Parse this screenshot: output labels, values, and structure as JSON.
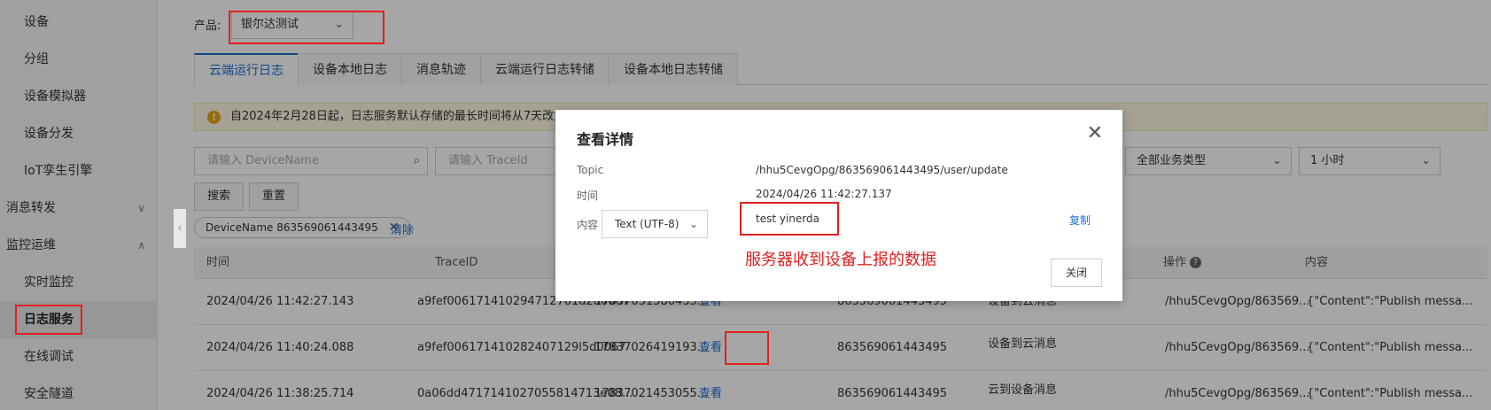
{
  "sidebar": {
    "items": [
      {
        "label": "设备",
        "type": "sub"
      },
      {
        "label": "分组",
        "type": "sub"
      },
      {
        "label": "设备模拟器",
        "type": "sub"
      },
      {
        "label": "设备分发",
        "type": "sub"
      },
      {
        "label": "IoT孪生引擎",
        "type": "sub"
      },
      {
        "label": "消息转发",
        "type": "group",
        "chevron": "∨"
      },
      {
        "label": "监控运维",
        "type": "group",
        "chevron": "∧"
      },
      {
        "label": "实时监控",
        "type": "sub"
      },
      {
        "label": "日志服务",
        "type": "sub",
        "active": true
      },
      {
        "label": "在线调试",
        "type": "sub"
      },
      {
        "label": "安全隧道",
        "type": "sub"
      }
    ]
  },
  "product": {
    "label": "产品:",
    "value": "银尔达测试"
  },
  "tabs": [
    "云端运行日志",
    "设备本地日志",
    "消息轨迹",
    "云端运行日志转储",
    "设备本地日志转储"
  ],
  "notice": {
    "text": "自2024年2月28日起，日志服务默认存储的最长时间将从7天改为3天，"
  },
  "filters": {
    "device_placeholder": "请输入 DeviceName",
    "trace_placeholder": "请输入 TraceId",
    "biz_type": "全部业务类型",
    "time_range": "1 小时"
  },
  "buttons": {
    "search": "搜索",
    "reset": "重置"
  },
  "tag": {
    "label": "DeviceName",
    "value": "863569061443495",
    "remove": "✕"
  },
  "clear_label": "清除",
  "table": {
    "columns": {
      "time": "时间",
      "trace": "TraceID",
      "ops": "操作",
      "content": "内容"
    },
    "rows": [
      {
        "time": "2024/04/26 11:42:27.143",
        "trace": "a9fef006171410294712761d2d0067",
        "msg": "17837031380435...",
        "action": "查看",
        "device": "863569061443495",
        "biz": "设备到云消息",
        "topic": "/hhu5CevgOpg/863569...",
        "content": "{\"Content\":\"Publish messa..."
      },
      {
        "time": "2024/04/26 11:40:24.088",
        "trace": "a9fef006171410282407129l5d0067",
        "msg": "17837026419193...",
        "action": "查看",
        "device": "863569061443495",
        "biz": "设备到云消息",
        "topic": "/hhu5CevgOpg/863569...",
        "content": "{\"Content\":\"Publish messa..."
      },
      {
        "time": "2024/04/26 11:38:25.714",
        "trace": "0a06dd4717141027055814713e08...",
        "msg": "17837021453055...",
        "action": "查看",
        "device": "863569061443495",
        "biz": "云到设备消息",
        "topic": "/hhu5CevgOpg/863569...",
        "content": "{\"Content\":\"Publish messa..."
      }
    ]
  },
  "dialog": {
    "title": "查看详情",
    "topic_label": "Topic",
    "topic_value": "/hhu5CevgOpg/863569061443495/user/update",
    "time_label": "时间",
    "time_value": "2024/04/26 11:42:27.137",
    "content_label": "内容",
    "format": "Text (UTF-8)",
    "content_value": "test yinerda",
    "copy": "复制",
    "close": "关闭",
    "annotation": "服务器收到设备上报的数据"
  },
  "colors": {
    "accent": "#1a6fd6",
    "highlight": "#e02020",
    "notice_bg": "#fdf7e3"
  }
}
